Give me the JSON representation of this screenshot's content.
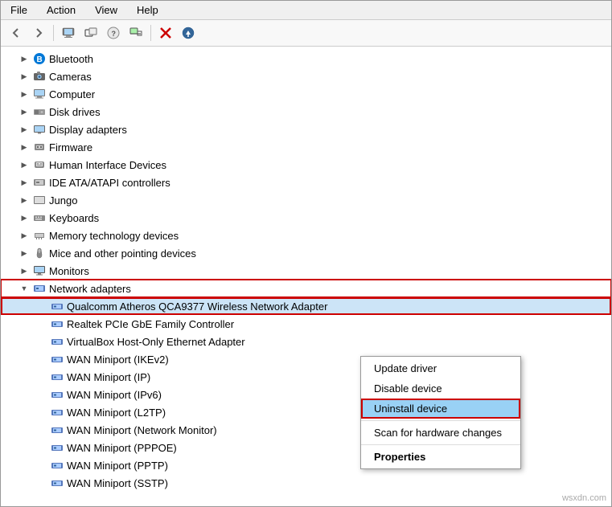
{
  "menu": {
    "items": [
      "File",
      "Action",
      "View",
      "Help"
    ]
  },
  "toolbar": {
    "buttons": [
      {
        "name": "back",
        "icon": "◀"
      },
      {
        "name": "forward",
        "icon": "▶"
      },
      {
        "name": "computer",
        "icon": "🖥"
      },
      {
        "name": "properties",
        "icon": "📋"
      },
      {
        "name": "help",
        "icon": "❓"
      },
      {
        "name": "scan",
        "icon": "🔍"
      },
      {
        "name": "delete",
        "icon": "✖"
      },
      {
        "name": "update",
        "icon": "⬇"
      }
    ]
  },
  "tree": {
    "items": [
      {
        "id": "bluetooth",
        "level": 1,
        "label": "Bluetooth",
        "icon": "bt",
        "expanded": false
      },
      {
        "id": "cameras",
        "level": 1,
        "label": "Cameras",
        "icon": "cam",
        "expanded": false
      },
      {
        "id": "computer",
        "level": 1,
        "label": "Computer",
        "icon": "pc",
        "expanded": false
      },
      {
        "id": "disk",
        "level": 1,
        "label": "Disk drives",
        "icon": "disk",
        "expanded": false
      },
      {
        "id": "display",
        "level": 1,
        "label": "Display adapters",
        "icon": "display",
        "expanded": false
      },
      {
        "id": "firmware",
        "level": 1,
        "label": "Firmware",
        "icon": "fw",
        "expanded": false
      },
      {
        "id": "hid",
        "level": 1,
        "label": "Human Interface Devices",
        "icon": "hid",
        "expanded": false
      },
      {
        "id": "ide",
        "level": 1,
        "label": "IDE ATA/ATAPI controllers",
        "icon": "ide",
        "expanded": false
      },
      {
        "id": "jungo",
        "level": 1,
        "label": "Jungo",
        "icon": "jungo",
        "expanded": false
      },
      {
        "id": "keyboards",
        "level": 1,
        "label": "Keyboards",
        "icon": "kb",
        "expanded": false
      },
      {
        "id": "memory",
        "level": 1,
        "label": "Memory technology devices",
        "icon": "mem",
        "expanded": false
      },
      {
        "id": "mice",
        "level": 1,
        "label": "Mice and other pointing devices",
        "icon": "mice",
        "expanded": false
      },
      {
        "id": "monitors",
        "level": 1,
        "label": "Monitors",
        "icon": "mon",
        "expanded": false
      },
      {
        "id": "network",
        "level": 1,
        "label": "Network adapters",
        "icon": "net",
        "expanded": true
      },
      {
        "id": "qualcomm",
        "level": 2,
        "label": "Qualcomm Atheros QCA9377 Wireless Network Adapter",
        "icon": "nic",
        "selected": true
      },
      {
        "id": "realtek",
        "level": 2,
        "label": "Realtek PCIe GbE Family Controller",
        "icon": "nic"
      },
      {
        "id": "virtualbox",
        "level": 2,
        "label": "VirtualBox Host-Only Ethernet Adapter",
        "icon": "nic"
      },
      {
        "id": "wan-ikev2",
        "level": 2,
        "label": "WAN Miniport (IKEv2)",
        "icon": "nic"
      },
      {
        "id": "wan-ip",
        "level": 2,
        "label": "WAN Miniport (IP)",
        "icon": "nic"
      },
      {
        "id": "wan-ipv6",
        "level": 2,
        "label": "WAN Miniport (IPv6)",
        "icon": "nic"
      },
      {
        "id": "wan-l2tp",
        "level": 2,
        "label": "WAN Miniport (L2TP)",
        "icon": "nic"
      },
      {
        "id": "wan-netmonitor",
        "level": 2,
        "label": "WAN Miniport (Network Monitor)",
        "icon": "nic"
      },
      {
        "id": "wan-pppoe",
        "level": 2,
        "label": "WAN Miniport (PPPOE)",
        "icon": "nic"
      },
      {
        "id": "wan-pptp",
        "level": 2,
        "label": "WAN Miniport (PPTP)",
        "icon": "nic"
      },
      {
        "id": "wan-sstp",
        "level": 2,
        "label": "WAN Miniport (SSTP)",
        "icon": "nic"
      }
    ]
  },
  "context_menu": {
    "items": [
      {
        "id": "update-driver",
        "label": "Update driver",
        "bold": false
      },
      {
        "id": "disable-device",
        "label": "Disable device",
        "bold": false
      },
      {
        "id": "uninstall-device",
        "label": "Uninstall device",
        "bold": false,
        "active": true
      },
      {
        "id": "scan-changes",
        "label": "Scan for hardware changes",
        "bold": false
      },
      {
        "id": "properties",
        "label": "Properties",
        "bold": true
      }
    ]
  },
  "watermark": "wsxdn.com"
}
